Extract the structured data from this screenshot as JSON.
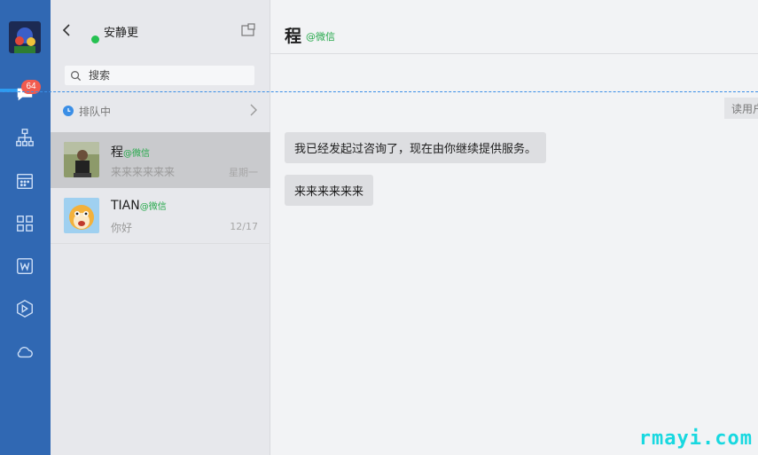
{
  "sidebar": {
    "badge_count": "64",
    "icons": [
      "chat-icon",
      "org-icon",
      "calendar-icon",
      "apps-icon",
      "word-icon",
      "cube-icon",
      "cloud-icon"
    ],
    "accent": "#3068b3"
  },
  "list_header": {
    "agent_name": "安静更",
    "status_color": "#25c151"
  },
  "search": {
    "placeholder": "搜索"
  },
  "queue": {
    "label": "排队中"
  },
  "conversations": [
    {
      "name": "程",
      "source": "@微信",
      "last_message": "来来来来来来",
      "time": "星期一",
      "active": true
    },
    {
      "name": "TIAN",
      "source": "@微信",
      "last_message": "你好",
      "time": "12/17",
      "active": false
    }
  ],
  "chat": {
    "title": "程",
    "source": "@微信",
    "read_tag": "读用户",
    "messages": [
      "我已经发起过咨询了，现在由你继续提供服务。",
      "来来来来来来"
    ]
  },
  "watermark": "rmayi.com"
}
